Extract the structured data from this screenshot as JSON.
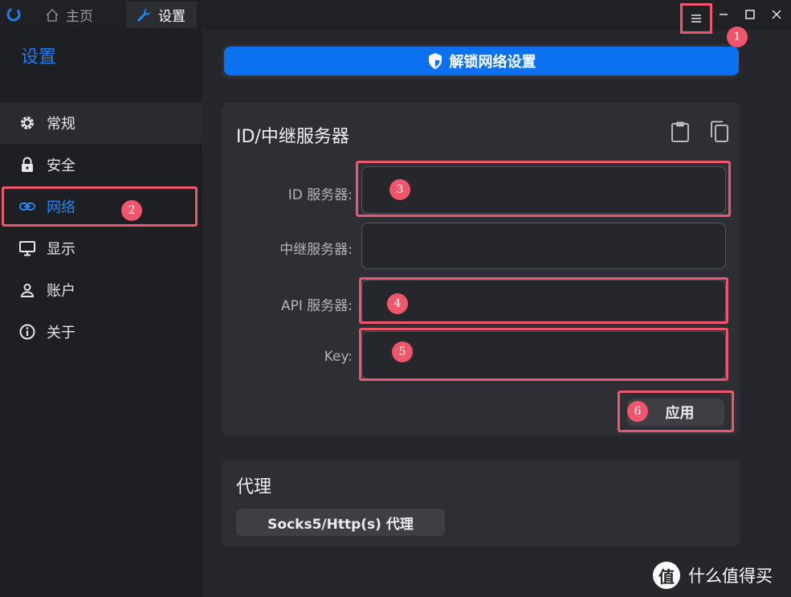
{
  "titlebar": {
    "tabs": [
      {
        "label": "主页",
        "icon": "home-icon"
      },
      {
        "label": "设置",
        "icon": "wrench-icon"
      }
    ],
    "controls": [
      "menu-icon",
      "minimize-icon",
      "maximize-icon",
      "close-icon"
    ]
  },
  "sidebar": {
    "title": "设置",
    "items": [
      {
        "label": "常规",
        "icon": "gear-icon"
      },
      {
        "label": "安全",
        "icon": "lock-icon"
      },
      {
        "label": "网络",
        "icon": "link-icon",
        "active": true
      },
      {
        "label": "显示",
        "icon": "monitor-icon"
      },
      {
        "label": "账户",
        "icon": "user-icon"
      },
      {
        "label": "关于",
        "icon": "info-icon"
      }
    ]
  },
  "main": {
    "unlock_label": "解锁网络设置",
    "server_card": {
      "title": "ID/中继服务器",
      "fields": [
        {
          "label": "ID 服务器:",
          "value": ""
        },
        {
          "label": "中继服务器:",
          "value": ""
        },
        {
          "label": "API 服务器:",
          "value": ""
        },
        {
          "label": "Key:",
          "value": ""
        }
      ],
      "apply_label": "应用"
    },
    "proxy_card": {
      "title": "代理",
      "button_label": "Socks5/Http(s) 代理"
    }
  },
  "annotations": [
    "1",
    "2",
    "3",
    "4",
    "5",
    "6"
  ],
  "watermark": {
    "text": "什么值得买",
    "logo_text": "值"
  },
  "colors": {
    "accent": "#0b71f0",
    "highlight": "#f0566b",
    "background": "#26272c"
  }
}
